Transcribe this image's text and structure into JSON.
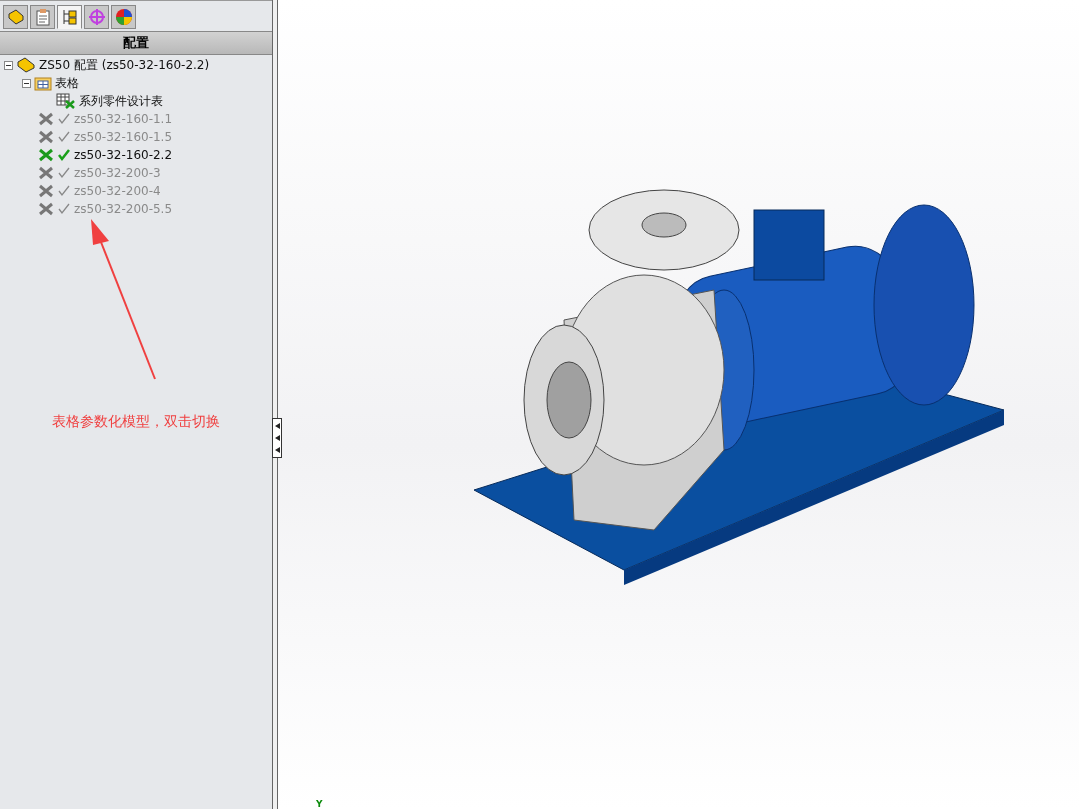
{
  "panel_tabs": [
    {
      "kind": "feature",
      "selected": false
    },
    {
      "kind": "property",
      "selected": false
    },
    {
      "kind": "configuration",
      "selected": true
    },
    {
      "kind": "dimxpert",
      "selected": false
    },
    {
      "kind": "display",
      "selected": false
    }
  ],
  "panel_title": "配置",
  "tree": {
    "label": "ZS50 配置  (zs50-32-160-2.2)",
    "expanded": true,
    "children": [
      {
        "kind": "folder",
        "label": "表格",
        "expanded": true,
        "children": [
          {
            "kind": "table",
            "label": "系列零件设计表"
          }
        ]
      },
      {
        "kind": "config",
        "label": "zs50-32-160-1.1",
        "active": false
      },
      {
        "kind": "config",
        "label": "zs50-32-160-1.5",
        "active": false
      },
      {
        "kind": "config",
        "label": "zs50-32-160-2.2",
        "active": true
      },
      {
        "kind": "config",
        "label": "zs50-32-200-3",
        "active": false
      },
      {
        "kind": "config",
        "label": "zs50-32-200-4",
        "active": false
      },
      {
        "kind": "config",
        "label": "zs50-32-200-5.5",
        "active": false
      }
    ]
  },
  "annotation": "表格参数化模型，双击切换",
  "axis_label": "Y"
}
